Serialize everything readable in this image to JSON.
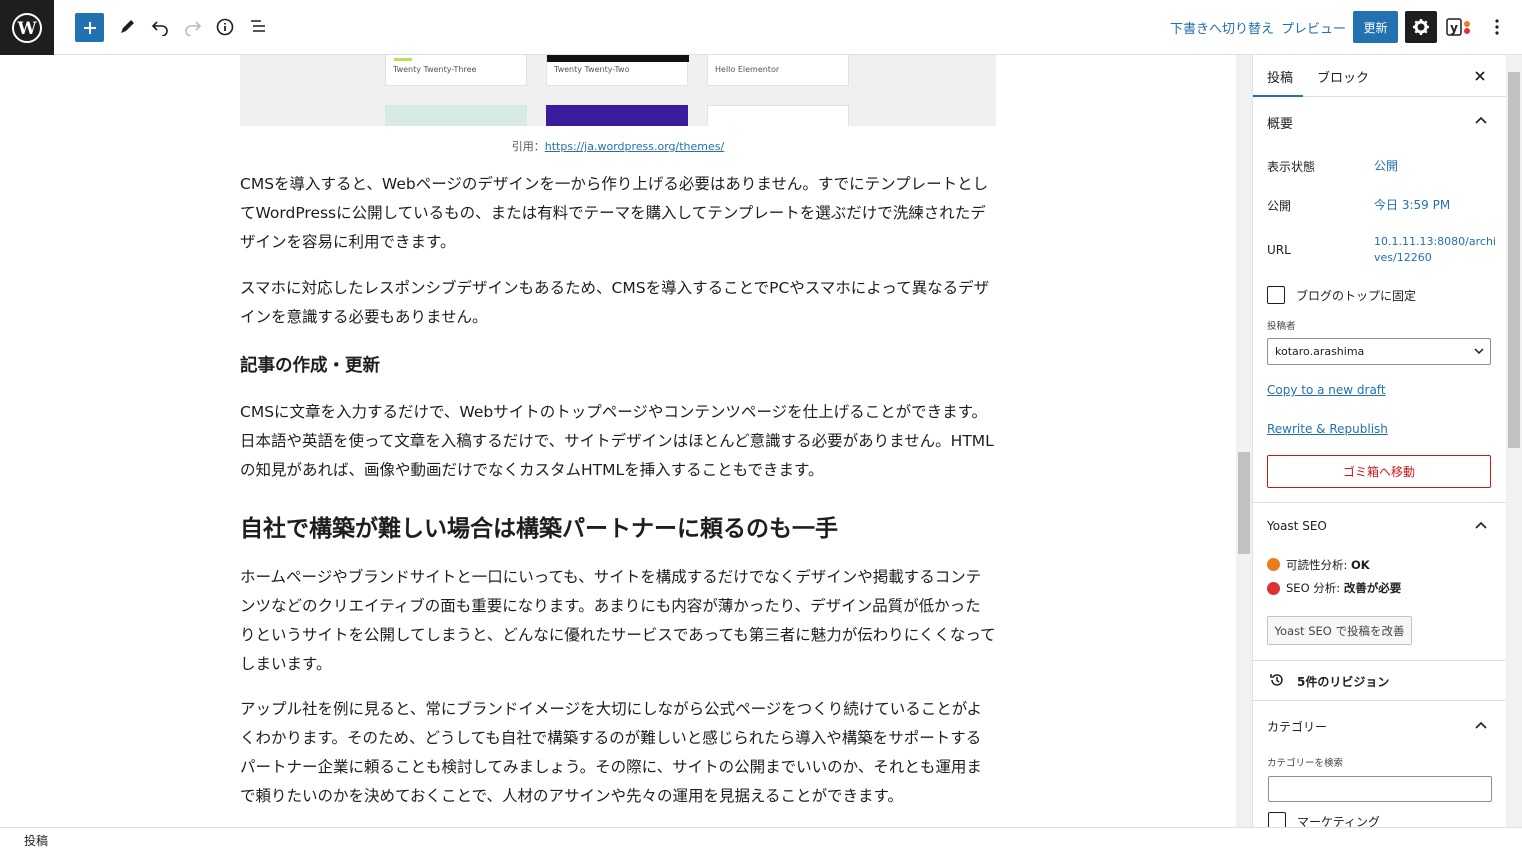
{
  "toolbar": {
    "switch_draft": "下書きへ切り替え",
    "preview": "プレビュー",
    "update": "更新"
  },
  "content": {
    "thumbnails": [
      "Twenty Twenty-Three",
      "Twenty Twenty-Two",
      "Hello Elementor"
    ],
    "caption_prefix": "引用：",
    "caption_link": "https://ja.wordpress.org/themes/",
    "para1": "CMSを導入すると、Webページのデザインを一から作り上げる必要はありません。すでにテンプレートとしてWordPressに公開しているもの、または有料でテーマを購入してテンプレートを選ぶだけで洗練されたデザインを容易に利用できます。",
    "para2": "スマホに対応したレスポンシブデザインもあるため、CMSを導入することでPCやスマホによって異なるデザインを意識する必要もありません。",
    "h3": "記事の作成・更新",
    "para3": "CMSに文章を入力するだけで、Webサイトのトップページやコンテンツページを仕上げることができます。日本語や英語を使って文章を入稿するだけで、サイトデザインはほとんど意識する必要がありません。HTMLの知見があれば、画像や動画だけでなくカスタムHTMLを挿入することもできます。",
    "h2": "自社で構築が難しい場合は構築パートナーに頼るのも一手",
    "para4": "ホームページやブランドサイトと一口にいっても、サイトを構成するだけでなくデザインや掲載するコンテンツなどのクリエイティブの面も重要になります。あまりにも内容が薄かったり、デザイン品質が低かったりというサイトを公開してしまうと、どんなに優れたサービスであっても第三者に魅力が伝わりにくくなってしまいます。",
    "para5": "アップル社を例に見ると、常にブランドイメージを大切にしながら公式ページをつくり続けていることがよくわかります。そのため、どうしても自社で構築するのが難しいと感じられたら導入や構築をサポートするパートナー企業に頼ることも検討してみましょう。その際に、サイトの公開までいいのか、それとも運用まで頼りたいのかを決めておくことで、人材のアサインや先々の運用を見据えることができます。"
  },
  "sidebar": {
    "tab_post": "投稿",
    "tab_block": "ブロック",
    "summary_title": "概要",
    "visibility_label": "表示状態",
    "visibility_value": "公開",
    "publish_label": "公開",
    "publish_value": "今日 3:59 PM",
    "url_label": "URL",
    "url_value_1": "10.1.11.13:8080/archi",
    "url_value_2": "ves/12260",
    "sticky_label": "ブログのトップに固定",
    "author_label": "投稿者",
    "author_value": "kotaro.arashima",
    "copy_draft": "Copy to a new draft",
    "rewrite": "Rewrite & Republish",
    "trash": "ゴミ箱へ移動",
    "yoast_title": "Yoast SEO",
    "readability_prefix": "可読性分析: ",
    "readability_value": "OK",
    "seo_prefix": "SEO 分析: ",
    "seo_value": "改善が必要",
    "yoast_button": "Yoast SEO で投稿を改善",
    "revisions": "5件のリビジョン",
    "category_title": "カテゴリー",
    "category_search_label": "カテゴリーを検索",
    "category_item": "マーケティング"
  },
  "footer": {
    "breadcrumb": "投稿"
  },
  "colors": {
    "accent": "#2271b1",
    "danger": "#cc1818",
    "dark": "#1e1e1e",
    "readability_ok": "#ee7c1b",
    "seo_bad": "#dc3232"
  }
}
